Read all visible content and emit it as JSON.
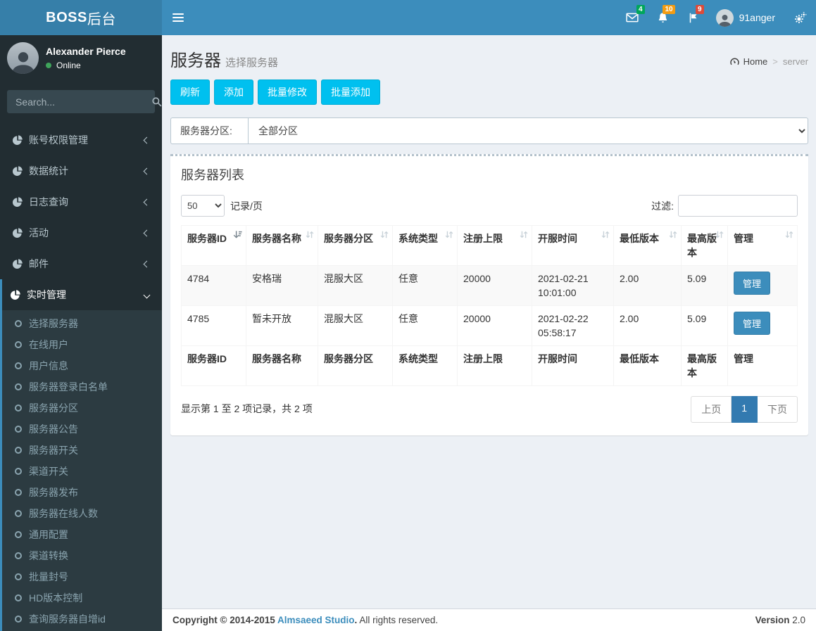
{
  "logo": {
    "bold": "BOSS",
    "light": "后台"
  },
  "navbar": {
    "username": "91anger",
    "messages_badge": "4",
    "notifications_badge": "10",
    "tasks_badge": "9"
  },
  "sidebar": {
    "user_name": "Alexander Pierce",
    "user_status": "Online",
    "search_placeholder": "Search...",
    "menu": [
      {
        "label": "账号权限管理",
        "state": "collapsed"
      },
      {
        "label": "数据统计",
        "state": "collapsed"
      },
      {
        "label": "日志查询",
        "state": "collapsed"
      },
      {
        "label": "活动",
        "state": "collapsed"
      },
      {
        "label": "邮件",
        "state": "collapsed"
      },
      {
        "label": "实时管理",
        "state": "expanded"
      }
    ],
    "submenu": [
      "选择服务器",
      "在线用户",
      "用户信息",
      "服务器登录白名单",
      "服务器分区",
      "服务器公告",
      "服务器开关",
      "渠道开关",
      "服务器发布",
      "服务器在线人数",
      "通用配置",
      "渠道转换",
      "批量封号",
      "HD版本控制",
      "查询服务器自增id"
    ]
  },
  "content": {
    "page_title": "服务器",
    "page_subtitle": "选择服务器",
    "breadcrumb": {
      "home": "Home",
      "separator": ">",
      "current": "server"
    },
    "toolbar_buttons": [
      "刷新",
      "添加",
      "批量修改",
      "批量添加"
    ],
    "zone_filter": {
      "label": "服务器分区:",
      "selected": "全部分区"
    },
    "panel": {
      "title": "服务器列表",
      "page_size": "50",
      "page_size_suffix": "记录/页",
      "filter_label": "过滤:",
      "columns": [
        "服务器ID",
        "服务器名称",
        "服务器分区",
        "系统类型",
        "注册上限",
        "开服时间",
        "最低版本",
        "最高版本",
        "管理"
      ],
      "rows": [
        {
          "id": "4784",
          "name": "安格瑞",
          "zone": "混服大区",
          "system": "任意",
          "reg_limit": "20000",
          "open_time": "2021-02-21 10:01:00",
          "min_version": "2.00",
          "max_version": "5.09",
          "action": "管理"
        },
        {
          "id": "4785",
          "name": "暂未开放",
          "zone": "混服大区",
          "system": "任意",
          "reg_limit": "20000",
          "open_time": "2021-02-22 05:58:17",
          "min_version": "2.00",
          "max_version": "5.09",
          "action": "管理"
        }
      ],
      "summary": "显示第 1 至 2 项记录，共 2 项",
      "pagination": {
        "prev": "上页",
        "current": "1",
        "next": "下页"
      }
    }
  },
  "footer": {
    "copyright_prefix": "Copyright © 2014-2015 ",
    "studio_link": "Almsaeed Studio",
    "copyright_suffix": ".",
    "rights": " All rights reserved.",
    "version_label": "Version",
    "version_value": "2.0"
  },
  "colors": {
    "navbar": "#3c8dbc",
    "logo_bg": "#367fa9",
    "sidebar_bg": "#222d32",
    "submenu_bg": "#2c3b41",
    "content_bg": "#ecf0f5",
    "info_button": "#00c0ef",
    "primary_button": "#3c8dbc",
    "badge_green": "#00a65a",
    "badge_yellow": "#f39c12",
    "badge_red": "#dd4b39",
    "pagination_active": "#337ab0",
    "online_green": "#3fa45b"
  },
  "icons": {
    "hamburger": "three-bars",
    "envelope": "mail",
    "bell": "notifications",
    "flag": "tasks",
    "gears": "settings",
    "search": "magnifier",
    "dashboard": "gauge",
    "pie_chart": "menu-section",
    "circle_o": "submenu-bullet",
    "chevron_left": "collapsed",
    "chevron_down": "expanded",
    "sort": "double-arrow"
  }
}
